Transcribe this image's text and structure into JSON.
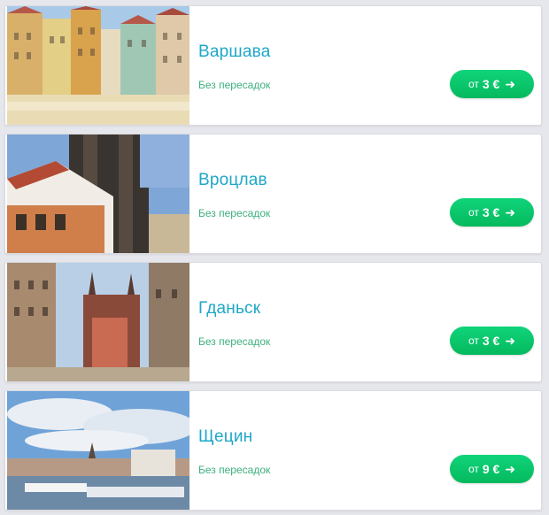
{
  "destinations": [
    {
      "city": "Варшава",
      "stops": "Без пересадок",
      "price_prefix": "от",
      "price": "3 €",
      "arrow_icon": "arrow-right-icon"
    },
    {
      "city": "Вроцлав",
      "stops": "Без пересадок",
      "price_prefix": "от",
      "price": "3 €",
      "arrow_icon": "arrow-right-icon"
    },
    {
      "city": "Гданьск",
      "stops": "Без пересадок",
      "price_prefix": "от",
      "price": "3 €",
      "arrow_icon": "arrow-right-icon"
    },
    {
      "city": "Щецин",
      "stops": "Без пересадок",
      "price_prefix": "от",
      "price": "9 €",
      "arrow_icon": "arrow-right-icon"
    }
  ],
  "colors": {
    "city_title": "#1ea7c8",
    "stops_text": "#3db07e",
    "price_button": "#0cc66b",
    "background": "#e6e7ec"
  }
}
